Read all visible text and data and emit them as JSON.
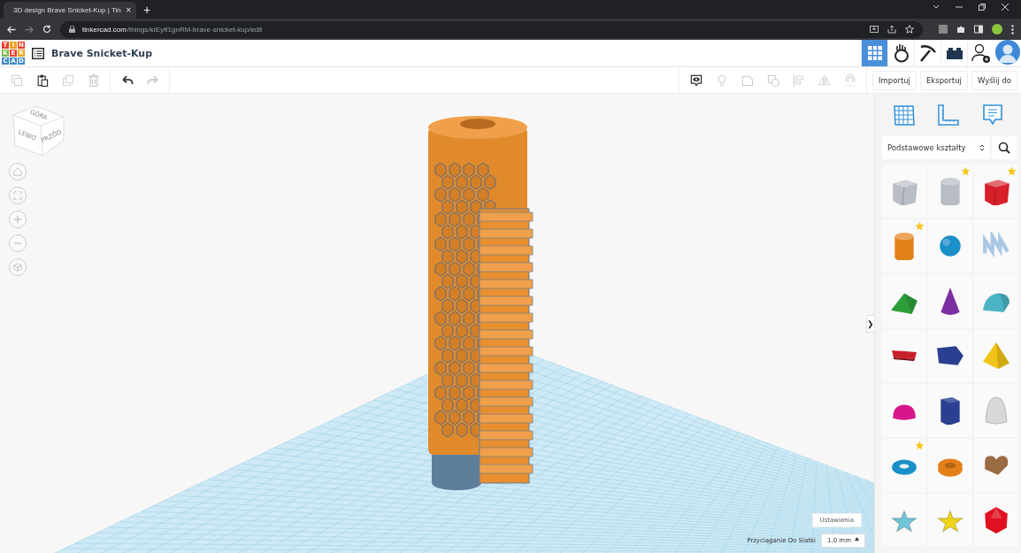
{
  "browser": {
    "tab_title": "3D design Brave Snicket-Kup | Tin",
    "close_tab": "✕",
    "new_tab": "+",
    "url_host": "tinkercad.com",
    "url_path": "/things/kIEyfI1gnRM-brave-snicket-kup/edit"
  },
  "logo": [
    {
      "letter": "T",
      "color": "#e8412c"
    },
    {
      "letter": "I",
      "color": "#f1a01e"
    },
    {
      "letter": "N",
      "color": "#e8412c"
    },
    {
      "letter": "K",
      "color": "#7ab648"
    },
    {
      "letter": "E",
      "color": "#e8412c"
    },
    {
      "letter": "R",
      "color": "#f1a01e"
    },
    {
      "letter": "C",
      "color": "#3f88c5"
    },
    {
      "letter": "A",
      "color": "#3f88c5"
    },
    {
      "letter": "D",
      "color": "#3f88c5"
    }
  ],
  "design_title": "Brave Snicket-Kup",
  "header_tabs": [
    {
      "kind": "grid",
      "selected": true
    },
    {
      "kind": "hand",
      "selected": false
    },
    {
      "kind": "pickaxe",
      "selected": false
    },
    {
      "kind": "brick",
      "selected": false
    },
    {
      "kind": "add-user",
      "selected": false
    }
  ],
  "edit_tools": [
    {
      "kind": "copy",
      "disabled": true
    },
    {
      "kind": "paste",
      "disabled": false
    },
    {
      "kind": "duplicate",
      "disabled": true
    },
    {
      "kind": "delete",
      "disabled": true
    },
    {
      "kind": "undo",
      "disabled": false
    },
    {
      "kind": "redo",
      "disabled": true
    }
  ],
  "view_tools": [
    {
      "kind": "note",
      "disabled": false
    },
    {
      "kind": "bulb",
      "disabled": true
    },
    {
      "kind": "group",
      "disabled": true
    },
    {
      "kind": "ungroup",
      "disabled": true
    },
    {
      "kind": "align",
      "disabled": true
    },
    {
      "kind": "mirror",
      "disabled": true
    },
    {
      "kind": "magnet",
      "disabled": true
    }
  ],
  "action_buttons": [
    "Importuj",
    "Eksportuj",
    "Wyślij do"
  ],
  "view_cube": {
    "top": "GÓRA",
    "left": "LEWO",
    "front": "PRZÓD"
  },
  "panel": {
    "toggle": "❯",
    "library": "Podstawowe kształty",
    "shapes": [
      {
        "kind": "box",
        "color": "#b8bcc4",
        "starred": false
      },
      {
        "kind": "cylinder",
        "color": "#b8bcc4",
        "starred": true
      },
      {
        "kind": "box",
        "color": "#d7202a",
        "starred": true
      },
      {
        "kind": "cylinder",
        "color": "#e3801a",
        "starred": true
      },
      {
        "kind": "sphere",
        "color": "#1a8fc8",
        "starred": false
      },
      {
        "kind": "scribble",
        "color": "#a9c8e6",
        "starred": false
      },
      {
        "kind": "roof",
        "color": "#2e9e3a",
        "starred": false
      },
      {
        "kind": "cone",
        "color": "#7b2fa0",
        "starred": false
      },
      {
        "kind": "round-roof",
        "color": "#4ab4c4",
        "starred": false
      },
      {
        "kind": "text",
        "color": "#c8202a",
        "starred": false
      },
      {
        "kind": "polygon",
        "color": "#2a3f8f",
        "starred": false
      },
      {
        "kind": "pyramid",
        "color": "#f0c418",
        "starred": false
      },
      {
        "kind": "half-sphere",
        "color": "#d8158a",
        "starred": false
      },
      {
        "kind": "hex-prism",
        "color": "#2a3f8f",
        "starred": false
      },
      {
        "kind": "paraboloid",
        "color": "#d8d8d8",
        "starred": false
      },
      {
        "kind": "torus",
        "color": "#1a8fc8",
        "starred": true
      },
      {
        "kind": "tube",
        "color": "#e3801a",
        "starred": false
      },
      {
        "kind": "heart",
        "color": "#9a6a42",
        "starred": false
      },
      {
        "kind": "star",
        "color": "#6fc4d8",
        "starred": false
      },
      {
        "kind": "star",
        "color": "#f0d418",
        "starred": false
      },
      {
        "kind": "icosahedron",
        "color": "#e01020",
        "starred": false
      }
    ]
  },
  "settings_button": "Ustawienia",
  "snap": {
    "label": "Przyciąganie Do Siatki",
    "value": "1,0 mm"
  }
}
